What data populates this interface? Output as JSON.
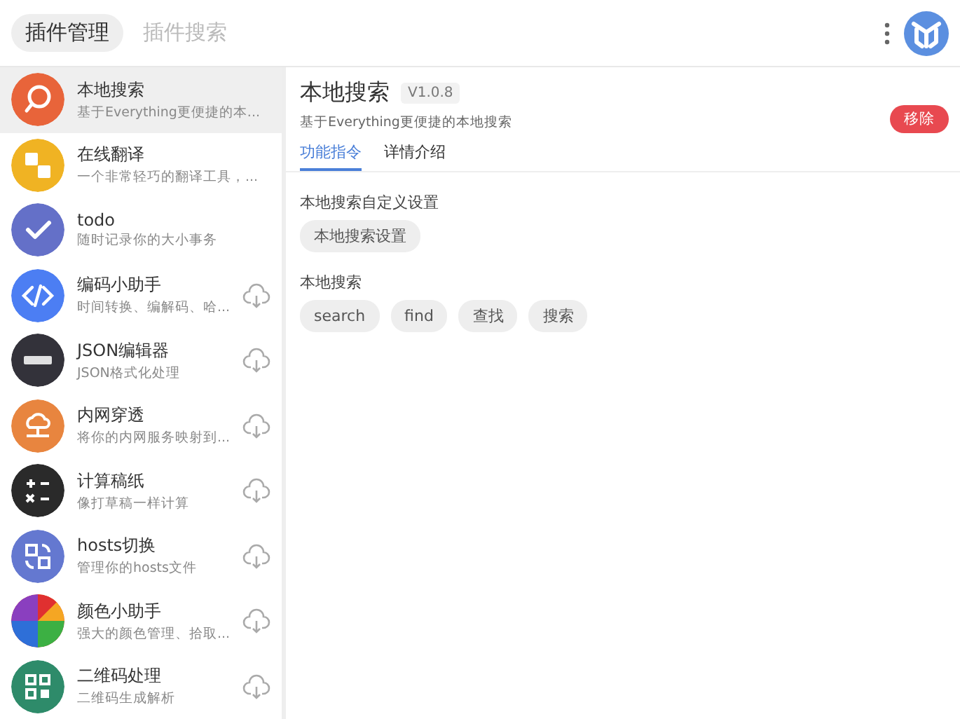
{
  "top_tabs": [
    {
      "label": "插件管理",
      "selected": true
    },
    {
      "label": "插件搜索",
      "selected": false
    }
  ],
  "plugins": [
    {
      "name": "本地搜索",
      "description": "基于Everything更便捷的本...",
      "kind": "search",
      "color": "#e8643a",
      "selected": true,
      "installed": true
    },
    {
      "name": "在线翻译",
      "description": "一个非常轻巧的翻译工具，...",
      "kind": "translate",
      "color": "#f0b323",
      "selected": false,
      "installed": true
    },
    {
      "name": "todo",
      "description": "随时记录你的大小事务",
      "kind": "check",
      "color": "#6470c8",
      "selected": false,
      "installed": true
    },
    {
      "name": "编码小助手",
      "description": "时间转换、编解码、哈...",
      "kind": "code",
      "color": "#4c7ef3",
      "selected": false,
      "installed": false
    },
    {
      "name": "JSON编辑器",
      "description": "JSON格式化处理",
      "kind": "json",
      "color": "#33323a",
      "selected": false,
      "installed": false
    },
    {
      "name": "内网穿透",
      "description": "将你的内网服务映射到...",
      "kind": "network",
      "color": "#e8853f",
      "selected": false,
      "installed": false
    },
    {
      "name": "计算稿纸",
      "description": "像打草稿一样计算",
      "kind": "calc",
      "color": "#2a2a2a",
      "selected": false,
      "installed": false
    },
    {
      "name": "hosts切换",
      "description": "管理你的hosts文件",
      "kind": "switch",
      "color": "#6478d0",
      "selected": false,
      "installed": false
    },
    {
      "name": "颜色小助手",
      "description": "强大的颜色管理、拾取...",
      "kind": "palette",
      "color": "#e03030",
      "selected": false,
      "installed": false
    },
    {
      "name": "二维码处理",
      "description": "二维码生成解析",
      "kind": "qr",
      "color": "#2e8b6a",
      "selected": false,
      "installed": false
    }
  ],
  "detail": {
    "title": "本地搜索",
    "version": "V1.0.8",
    "description": "基于Everything更便捷的本地搜索",
    "remove_button": "移除",
    "tabs": [
      {
        "label": "功能指令",
        "selected": true
      },
      {
        "label": "详情介绍",
        "selected": false
      }
    ],
    "sections": [
      {
        "heading": "本地搜索自定义设置",
        "commands": [
          "本地搜索设置"
        ]
      },
      {
        "heading": "本地搜索",
        "commands": [
          "search",
          "find",
          "查找",
          "搜索"
        ]
      }
    ]
  }
}
